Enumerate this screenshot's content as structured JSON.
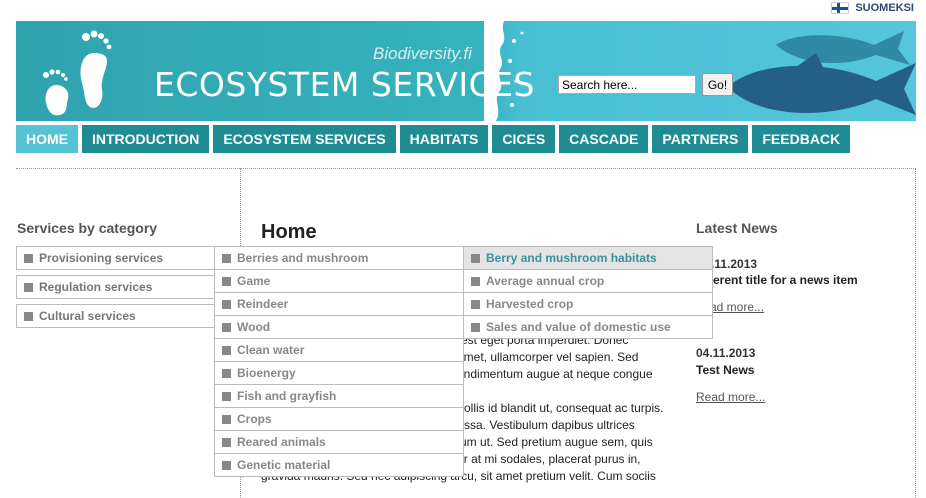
{
  "lang_link": "SUOMEKSI",
  "header": {
    "subtitle": "Biodiversity.fi",
    "title": "ECOSYSTEM SERVICES"
  },
  "search": {
    "value": "Search here...",
    "button": "Go!"
  },
  "nav": [
    "HOME",
    "INTRODUCTION",
    "ECOSYSTEM SERVICES",
    "HABITATS",
    "CICES",
    "CASCADE",
    "PARTNERS",
    "FEEDBACK"
  ],
  "sidebar": {
    "title": "Services by category",
    "categories": [
      "Provisioning services",
      "Regulation services",
      "Cultural services"
    ]
  },
  "main": {
    "title": "Home",
    "paragraphs": [
      [
        "est eget porta imperdiet. Donec",
        "amet, ullamcorper vel sapien. Sed",
        "ondimentum augue at neque congue"
      ],
      [
        "ollis id blandit ut, consequat ac turpis.",
        "ssa. Vestibulum dapibus ultrices",
        "um ut. Sed pretium augue sem, quis",
        "tristique magna suscipit quis. Curabitur at mi sodales, placerat purus in,",
        "gravida mauris. Sed nec adipiscing arcu, sit amet pretium velit. Cum sociis"
      ]
    ]
  },
  "news": {
    "title": "Latest News",
    "items": [
      {
        "date": ".11.2013",
        "headline": "ferent title for a news item",
        "more": "ad more..."
      },
      {
        "date": "04.11.2013",
        "headline": "Test News",
        "more": "Read more..."
      }
    ]
  },
  "flyout1": [
    "Berries and mushroom",
    "Game",
    "Reindeer",
    "Wood",
    "Clean water",
    "Bioenergy",
    "Fish and grayfish",
    "Crops",
    "Reared animals",
    "Genetic material"
  ],
  "flyout2": [
    "Berry and mushroom habitats",
    "Average annual crop",
    "Harvested crop",
    "Sales and value of domestic use"
  ],
  "colors": {
    "banner": "#36b3bd",
    "nav": "#1f8b92",
    "nav_active": "#56c3d4",
    "highlight": "#3a8fa0"
  }
}
